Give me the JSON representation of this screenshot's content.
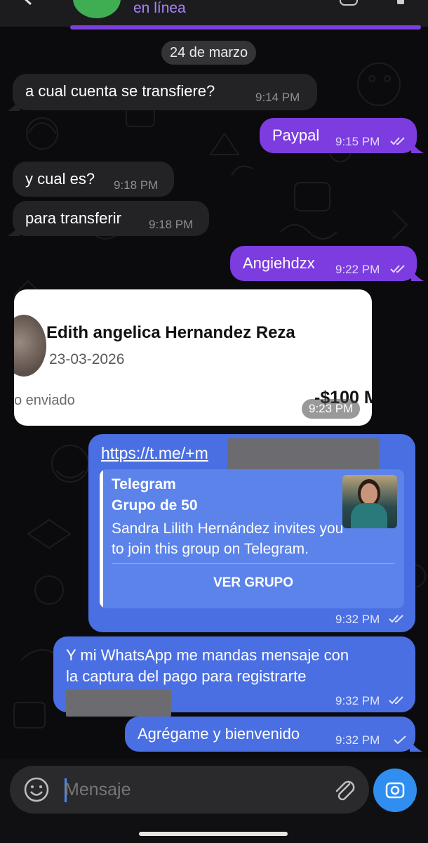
{
  "header": {
    "status": "en línea"
  },
  "date_chip": "24 de marzo",
  "messages": [
    {
      "text": "a cual cuenta se transfiere?",
      "time": "9:14 PM"
    },
    {
      "text": "Paypal",
      "time": "9:15 PM"
    },
    {
      "text": "y cual es?",
      "time": "9:18 PM"
    },
    {
      "text": "para transferir",
      "time": "9:18 PM"
    },
    {
      "text": "Angiehdzx",
      "time": "9:22 PM"
    },
    {
      "line1": "Y mi WhatsApp me mandas mensaje con",
      "line2": "la captura del pago para registrarte",
      "time": "9:32 PM"
    },
    {
      "text": "Agrégame y bienvenido",
      "time": "9:32 PM"
    }
  ],
  "image_message": {
    "name": "Edith angelica Hernandez  Reza",
    "date": "23-03-2026",
    "sent_label": "o enviado",
    "amount": "-$100 M",
    "time": "9:23 PM"
  },
  "link_message": {
    "url": "https://t.me/+m",
    "preview_site": "Telegram",
    "preview_title": "Grupo de 50",
    "preview_desc": "Sandra Lilith Hernández invites you to join this group on Telegram.",
    "button": "VER GRUPO",
    "time": "9:32 PM"
  },
  "input": {
    "placeholder": "Mensaje"
  },
  "colors": {
    "purple_bubble": "#7c3ce0",
    "blue_bubble": "#4a6fe2",
    "incoming_bubble": "#232325",
    "accent_link": "#a983ff",
    "camera_button": "#2f8ef0"
  },
  "icons": [
    "back-icon",
    "avatar",
    "emoji-icon",
    "attach-icon",
    "camera-icon",
    "double-check-icon",
    "single-check-icon"
  ]
}
